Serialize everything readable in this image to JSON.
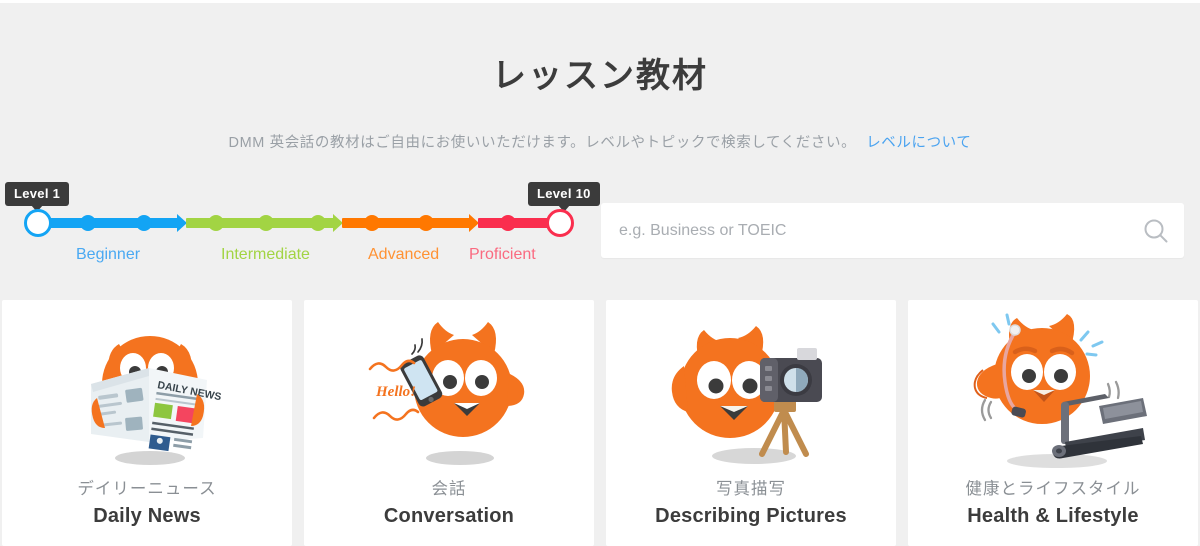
{
  "page": {
    "title": "レッスン教材",
    "subtitle": "DMM 英会話の教材はご自由にお使いいただけます。レベルやトピックで検索してください。",
    "level_link": "レベルについて",
    "background_color": "#f0f0f0"
  },
  "level_slider": {
    "min_badge": "Level 1",
    "max_badge": "Level 10",
    "min_value": 1,
    "max_value": 10,
    "segments": [
      {
        "label": "Beginner",
        "color": "#13a4f4"
      },
      {
        "label": "Intermediate",
        "color": "#a2d443"
      },
      {
        "label": "Advanced",
        "color": "#ff7800"
      },
      {
        "label": "Proficient",
        "color": "#fa2e4e"
      }
    ]
  },
  "search": {
    "value": "",
    "placeholder": "e.g. Business or TOEIC",
    "icon": "search-icon"
  },
  "cards": [
    {
      "title_ja": "デイリーニュース",
      "title_en": "Daily News",
      "art": "cat-reading-newspaper",
      "art_label": "DAILY NEWS"
    },
    {
      "title_ja": "会話",
      "title_en": "Conversation",
      "art": "cat-with-phone",
      "art_label": "Hello!"
    },
    {
      "title_ja": "写真描写",
      "title_en": "Describing Pictures",
      "art": "cat-with-camera",
      "art_label": ""
    },
    {
      "title_ja": "健康とライフスタイル",
      "title_en": "Health & Lifestyle",
      "art": "cat-on-treadmill",
      "art_label": ""
    }
  ]
}
